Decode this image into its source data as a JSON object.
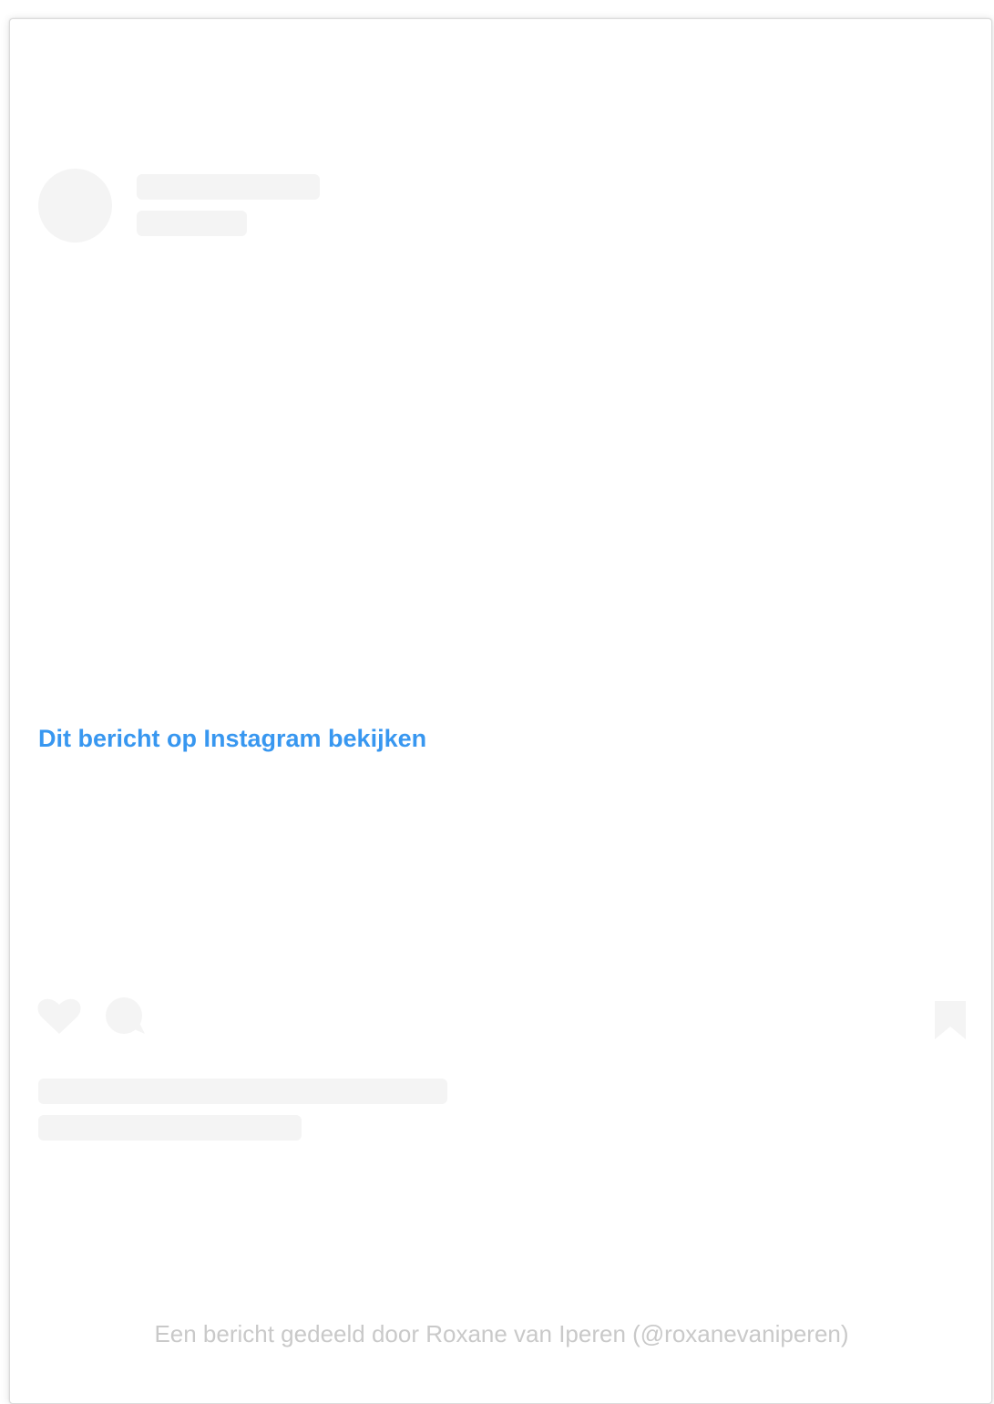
{
  "embed": {
    "view_link_label": "Dit bericht op Instagram bekijken",
    "footer_caption": "Een bericht gedeeld door Roxane van Iperen (@roxanevaniperen)",
    "placeholder_color": "#f4f4f4",
    "link_color": "#3897f0",
    "icons": {
      "like": "heart-icon",
      "comment": "comment-icon",
      "save": "bookmark-icon"
    }
  }
}
